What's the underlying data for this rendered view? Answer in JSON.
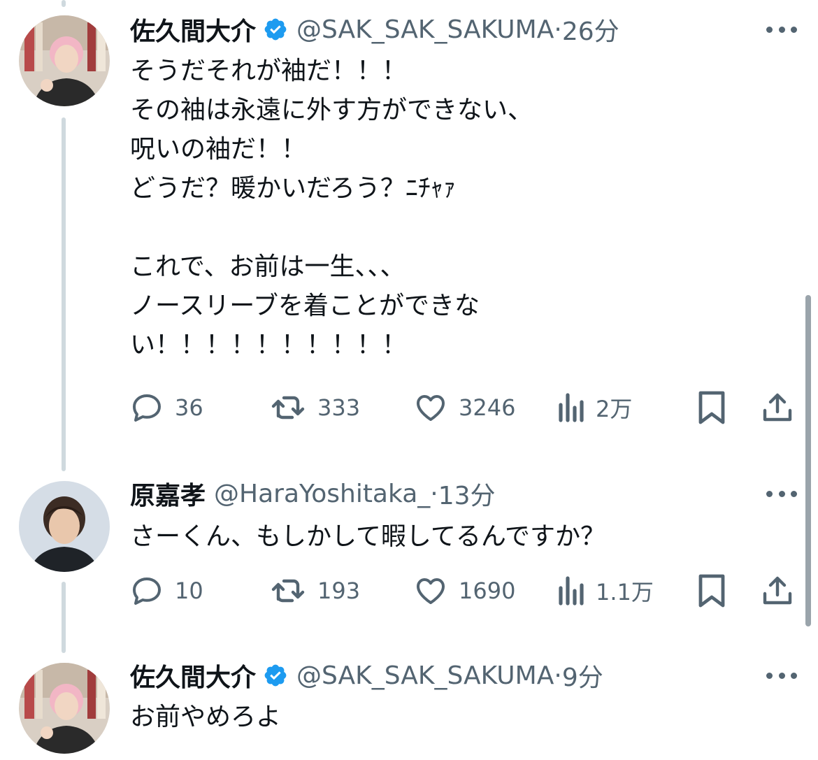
{
  "tweets": [
    {
      "author": "佐久間大介",
      "handle": "@SAK_SAK_SAKUMA",
      "dot": "·",
      "time": "26分",
      "verified": true,
      "lines": [
        "そうだそれが袖だ！！！",
        "その袖は永遠に外す方ができない、",
        "呪いの袖だ！！",
        "どうだ？暖かいだろう？ﾆﾁｬｧ",
        "",
        "これで、お前は一生、、、",
        "ノースリーブを着ことができな",
        "い！！！！！！！！！！"
      ],
      "replies": "36",
      "retweets": "333",
      "likes": "3246",
      "views": "2万"
    },
    {
      "author": "原嘉孝",
      "handle": "@HaraYoshitaka_",
      "dot": "·",
      "time": "13分",
      "verified": false,
      "lines": [
        "さーくん、もしかして暇してるんですか？"
      ],
      "replies": "10",
      "retweets": "193",
      "likes": "1690",
      "views": "1.1万"
    },
    {
      "author": "佐久間大介",
      "handle": "@SAK_SAK_SAKUMA",
      "dot": "·",
      "time": "9分",
      "verified": true,
      "lines": [
        "お前やめろよ"
      ]
    }
  ],
  "icons": {
    "reply": "speech-bubble",
    "retweet": "repost-arrows",
    "like": "heart",
    "views": "bar-chart",
    "bookmark": "bookmark",
    "share": "upload-arrow",
    "more": "three-dots",
    "verified": "blue-check-badge"
  },
  "colors": {
    "text": "#0f1419",
    "secondary": "#536471",
    "verified_blue": "#1d9bf0",
    "thread_line": "#cfd9de"
  }
}
